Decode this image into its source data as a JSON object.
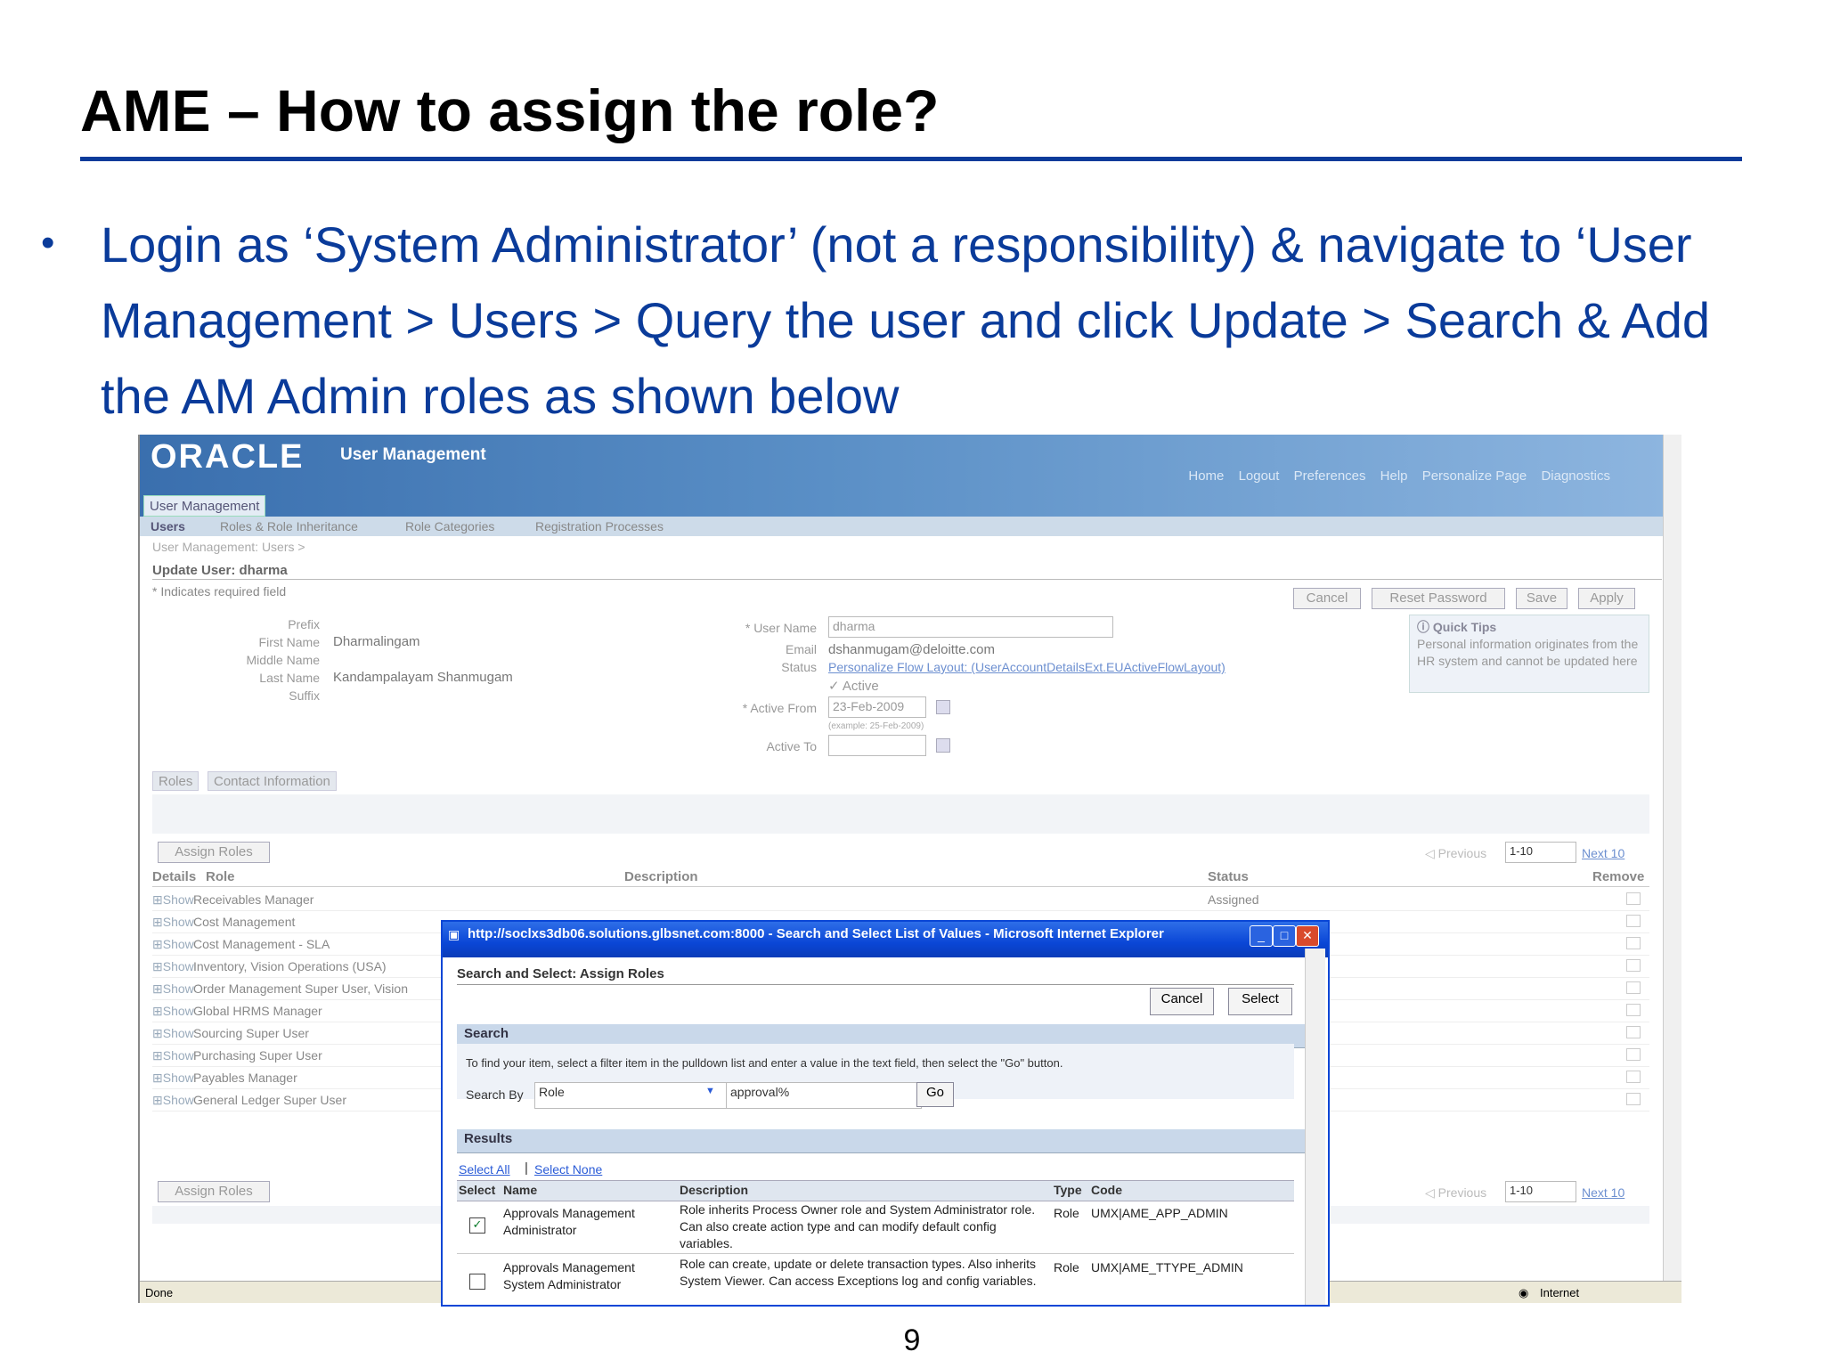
{
  "slide": {
    "title": "AME – How to assign the role?",
    "bullet": "Login as ‘System Administrator’ (not a responsibility) & navigate to ‘User Management > Users > Query the user and click Update > Search & Add the AM Admin roles as shown below",
    "page_number": "9"
  },
  "app": {
    "logo": "ORACLE",
    "name": "User Management",
    "global_links": [
      "Home",
      "Logout",
      "Preferences",
      "Help",
      "Personalize Page",
      "Diagnostics"
    ],
    "tab": "User Management",
    "subtabs": [
      "Users",
      "Roles & Role Inheritance",
      "Role Categories",
      "Registration Processes"
    ],
    "breadcrumb": "User Management: Users  >",
    "page_title": "Update User: dharma",
    "required_note": "* Indicates required field",
    "buttons": {
      "cancel": "Cancel",
      "reset_password": "Reset Password",
      "save": "Save",
      "apply": "Apply"
    },
    "person": {
      "prefix_label": "Prefix",
      "first_name_label": "First Name",
      "first_name": "Dharmalingam",
      "middle_name_label": "Middle Name",
      "last_name_label": "Last Name",
      "last_name": "Kandampalayam Shanmugam",
      "suffix_label": "Suffix"
    },
    "account": {
      "user_name_label": "* User Name",
      "user_name": "dharma",
      "email_label": "Email",
      "email": "dshanmugam@deloitte.com",
      "status_label": "Status",
      "status_link": "Personalize Flow Layout: (UserAccountDetailsExt.EUActiveFlowLayout)",
      "status_value": "Active",
      "active_from_label": "* Active From",
      "active_from": "23-Feb-2009",
      "example": "(example: 25-Feb-2009)",
      "active_to_label": "Active To"
    },
    "quick_tips": {
      "title": "Quick Tips",
      "text": "Personal information originates from the HR system and cannot be updated here"
    },
    "section_tabs": [
      "Roles",
      "Contact Information"
    ],
    "assign_roles_button": "Assign Roles",
    "nav": {
      "previous": "Previous",
      "range": "1-10",
      "next": "Next 10"
    },
    "roles_table": {
      "headers": [
        "Details",
        "Role",
        "Description",
        "Status",
        "Remove"
      ],
      "show_label": "Show",
      "rows": [
        {
          "role": "Receivables Manager",
          "status": "Assigned"
        },
        {
          "role": "Cost Management",
          "status": ""
        },
        {
          "role": "Cost Management - SLA",
          "status": ""
        },
        {
          "role": "Inventory, Vision Operations (USA)",
          "status": ""
        },
        {
          "role": "Order Management Super User, Vision",
          "status": ""
        },
        {
          "role": "Global HRMS Manager",
          "status": ""
        },
        {
          "role": "Sourcing Super User",
          "status": ""
        },
        {
          "role": "Purchasing Super User",
          "status": ""
        },
        {
          "role": "Payables Manager",
          "status": ""
        },
        {
          "role": "General Ledger Super User",
          "status": ""
        }
      ]
    },
    "statusbar": {
      "left": "Done",
      "right": "Internet"
    }
  },
  "popup": {
    "title": "http://soclxs3db06.solutions.glbsnet.com:8000 - Search and Select List of Values - Microsoft Internet Explorer",
    "heading": "Search and Select: Assign Roles",
    "cancel": "Cancel",
    "select": "Select",
    "search_section": "Search",
    "instructions": "To find your item, select a filter item in the pulldown list and enter a value in the text field, then select the \"Go\" button.",
    "search_by_label": "Search By",
    "search_by_value": "Role",
    "search_text": "approval%",
    "go": "Go",
    "results_section": "Results",
    "select_all": "Select All",
    "select_none": "Select None",
    "headers": [
      "Select",
      "Name",
      "Description",
      "Type",
      "Code"
    ],
    "rows": [
      {
        "checked": true,
        "name": "Approvals Management Administrator",
        "description": "Role inherits Process Owner role and System Administrator role. Can also create action type and can modify default config variables.",
        "type": "Role",
        "code": "UMX|AME_APP_ADMIN"
      },
      {
        "checked": false,
        "name": "Approvals Management System Administrator",
        "description": "Role can create, update or delete transaction types. Also inherits System Viewer. Can access Exceptions log and config variables.",
        "type": "Role",
        "code": "UMX|AME_TTYPE_ADMIN"
      }
    ]
  }
}
